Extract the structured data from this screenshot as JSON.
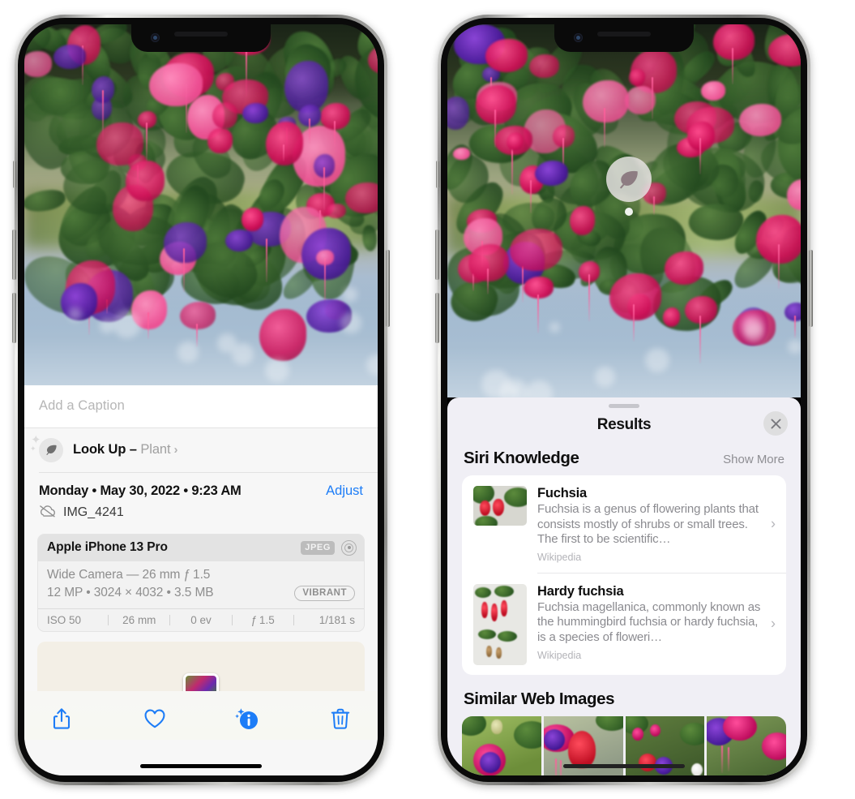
{
  "left_phone": {
    "caption": {
      "placeholder": "Add a Caption",
      "value": ""
    },
    "lookup": {
      "icon": "leaf-icon",
      "label": "Look Up – ",
      "subject": "Plant",
      "chevron": "›"
    },
    "date": {
      "text": "Monday • May 30, 2022 • 9:23 AM",
      "adjust_label": "Adjust"
    },
    "file": {
      "icon": "cloud-slash-icon",
      "name": "IMG_4241"
    },
    "exif": {
      "device": "Apple iPhone 13 Pro",
      "format_badge": "JPEG",
      "raw_icon": "raw-target-icon",
      "lens": "Wide Camera — 26 mm ƒ 1.5",
      "size": "12 MP • 3024 × 4032 • 3.5 MB",
      "style_badge": "VIBRANT",
      "stats": [
        "ISO 50",
        "26 mm",
        "0 ev",
        "ƒ 1.5",
        "1/181 s"
      ]
    },
    "toolbar": [
      {
        "name": "share-button",
        "icon": "share-icon"
      },
      {
        "name": "favorite-button",
        "icon": "heart-icon"
      },
      {
        "name": "info-button",
        "icon": "info-sparkle-icon"
      },
      {
        "name": "delete-button",
        "icon": "trash-icon"
      }
    ]
  },
  "right_phone": {
    "lens_badge": {
      "icon": "leaf-icon"
    },
    "sheet": {
      "title": "Results",
      "close_icon": "close-icon",
      "sections": [
        {
          "title": "Siri Knowledge",
          "action": "Show More",
          "items": [
            {
              "title": "Fuchsia",
              "snippet": "Fuchsia is a genus of flowering plants that consists mostly of shrubs or small trees. The first to be scientific…",
              "source": "Wikipedia",
              "chevron": "›"
            },
            {
              "title": "Hardy fuchsia",
              "snippet": "Fuchsia magellanica, commonly known as the hummingbird fuchsia or hardy fuchsia, is a species of floweri…",
              "source": "Wikipedia",
              "chevron": "›"
            }
          ]
        },
        {
          "title": "Similar Web Images",
          "tiles": [
            "web-image-1",
            "web-image-2",
            "web-image-3",
            "web-image-4"
          ]
        }
      ]
    }
  },
  "colors": {
    "accent_blue": "#1d7df7",
    "panel_bg": "#f7f7f7",
    "sheet_bg": "#f0eff5",
    "card_bg": "#ffffff",
    "secondary_text": "#8e8e93"
  }
}
